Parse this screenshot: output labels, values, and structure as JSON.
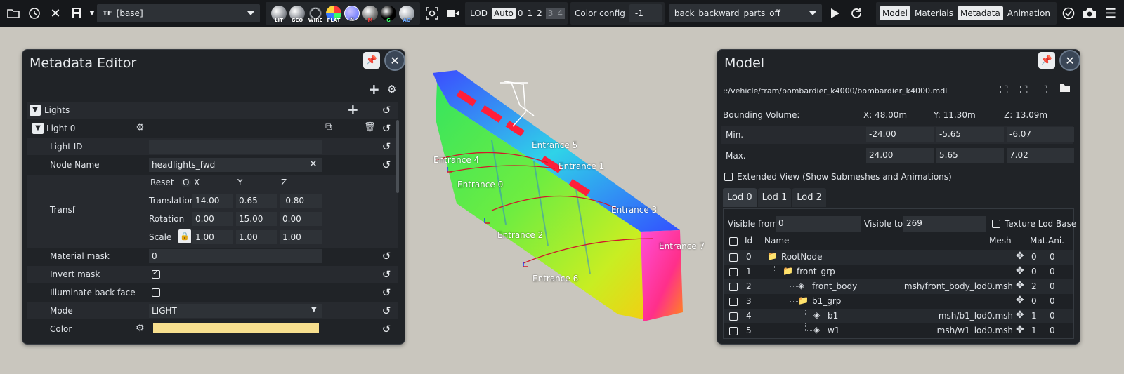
{
  "toolbar": {
    "preset_value": "[base]",
    "preset_prefix": "TF",
    "render_balls": [
      "LIT",
      "GEO",
      "WIRE",
      "FLAT",
      "N",
      "M",
      "G",
      "AO"
    ],
    "lod_label": "LOD",
    "lod_auto": "Auto",
    "lod_values": [
      "0",
      "1",
      "2"
    ],
    "lod_disabled": [
      "3",
      "4"
    ],
    "color_config_label": "Color config",
    "color_config_value": "-1",
    "config_value": "back_backward_parts_off",
    "tabs": [
      "Model",
      "Materials",
      "Metadata",
      "Animation"
    ]
  },
  "metadata_editor": {
    "title": "Metadata Editor",
    "lights_label": "Lights",
    "light_label": "Light 0",
    "rows": {
      "light_id": {
        "label": "Light ID",
        "value": ""
      },
      "node_name": {
        "label": "Node Name",
        "value": "headlights_fwd"
      },
      "transf": {
        "label": "Transf"
      },
      "material_mask": {
        "label": "Material mask",
        "value": "0"
      },
      "invert_mask": {
        "label": "Invert mask",
        "checked": true
      },
      "illuminate_back": {
        "label": "Illuminate back face",
        "checked": false
      },
      "mode": {
        "label": "Mode",
        "value": "LIGHT"
      },
      "color": {
        "label": "Color",
        "swatch": "#f7df8e"
      }
    },
    "transform": {
      "reset_label": "Reset",
      "o_label": "O",
      "axes": [
        "X",
        "Y",
        "Z"
      ],
      "translation": {
        "label": "Translation",
        "values": [
          "14.00",
          "0.65",
          "-0.80"
        ]
      },
      "rotation": {
        "label": "Rotation",
        "values": [
          "0.00",
          "15.00",
          "0.00"
        ]
      },
      "scale": {
        "label": "Scale",
        "values": [
          "1.00",
          "1.00",
          "1.00"
        ]
      }
    }
  },
  "viewport": {
    "labels": [
      "Entrance 4",
      "Entrance 0",
      "Entrance 5",
      "Entrance 1",
      "Entrance 3",
      "Entrance 2",
      "Entrance 7",
      "Entrance 6"
    ]
  },
  "model_panel": {
    "title": "Model",
    "path": "::/vehicle/tram/bombardier_k4000/bombardier_k4000.mdl",
    "bounding_label": "Bounding Volume:",
    "bx": "X: 48.00m",
    "by": "Y: 11.30m",
    "bz": "Z: 13.09m",
    "min_label": "Min.",
    "min": [
      "-24.00",
      "-5.65",
      "-6.07"
    ],
    "max_label": "Max.",
    "max": [
      "24.00",
      "5.65",
      "7.02"
    ],
    "extended_view": "Extended View (Show Submeshes and Animations)",
    "lod_tabs": [
      "Lod 0",
      "Lod 1",
      "Lod 2"
    ],
    "visible_from_label": "Visible from:",
    "visible_from": "0",
    "visible_to_label": "Visible to:",
    "visible_to": "269",
    "texture_lod_base": "Texture Lod Base",
    "columns": {
      "id": "Id",
      "name": "Name",
      "mesh": "Mesh",
      "mat": "Mat.",
      "ani": "Ani."
    },
    "tree": [
      {
        "id": "0",
        "name": "RootNode",
        "mesh": "",
        "mat": "0",
        "ani": "0"
      },
      {
        "id": "1",
        "name": "front_grp",
        "mesh": "",
        "mat": "0",
        "ani": "0"
      },
      {
        "id": "2",
        "name": "front_body",
        "mesh": "msh/front_body_lod0.msh",
        "mat": "2",
        "ani": "0"
      },
      {
        "id": "3",
        "name": "b1_grp",
        "mesh": "",
        "mat": "0",
        "ani": "0"
      },
      {
        "id": "4",
        "name": "b1",
        "mesh": "msh/b1_lod0.msh",
        "mat": "1",
        "ani": "0"
      },
      {
        "id": "5",
        "name": "w1",
        "mesh": "msh/w1_lod0.msh",
        "mat": "1",
        "ani": "0"
      }
    ]
  }
}
